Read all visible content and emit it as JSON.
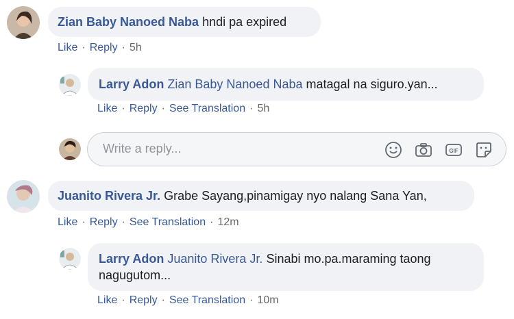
{
  "comments": [
    {
      "author": "Zian Baby Nanoed Naba",
      "text": "hndi pa expired",
      "like": "Like",
      "reply": "Reply",
      "time": "5h",
      "reply_comment": {
        "author": "Larry Adon",
        "tag": "Zian Baby Nanoed Naba",
        "text": "matagal na siguro.yan...",
        "like": "Like",
        "reply": "Reply",
        "translate": "See Translation",
        "time": "5h"
      }
    },
    {
      "author": "Juanito Rivera Jr.",
      "text": "Grabe Sayang,pinamigay nyo nalang Sana Yan,",
      "like": "Like",
      "reply": "Reply",
      "translate": "See Translation",
      "time": "12m",
      "reply_comment": {
        "author": "Larry Adon",
        "tag": "Juanito Rivera Jr.",
        "text_line1": "Sinabi mo.pa.maraming taong",
        "text_line2": "nagugutom...",
        "like": "Like",
        "reply": "Reply",
        "translate": "See Translation",
        "time": "10m"
      }
    }
  ],
  "reply_box": {
    "placeholder": "Write a reply...",
    "icons": [
      "emoji-icon",
      "camera-icon",
      "gif-icon",
      "sticker-icon"
    ]
  },
  "colors": {
    "link": "#385898",
    "bubble": "#f0f2f5",
    "meta": "#65676b"
  }
}
